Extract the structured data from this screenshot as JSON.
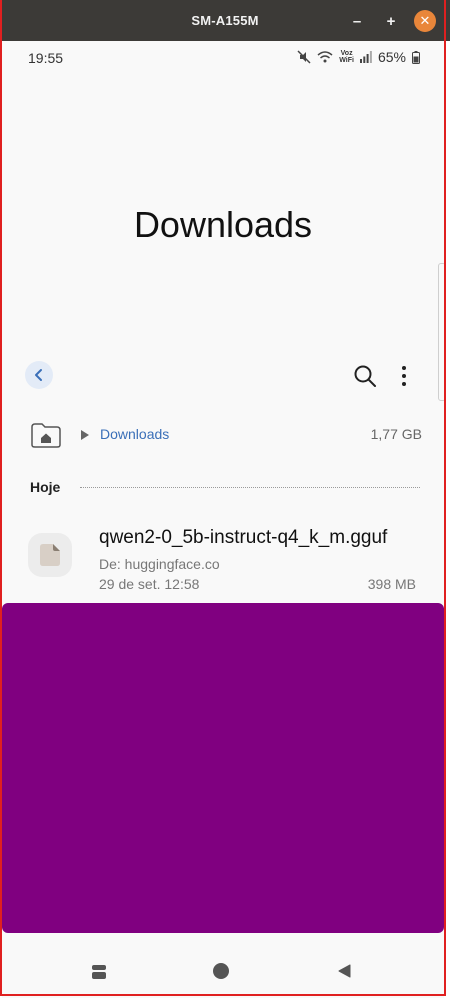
{
  "window": {
    "title": "SM-A155M"
  },
  "status_bar": {
    "time": "19:55",
    "battery": "65%",
    "voz_wifi_line1": "Voz",
    "voz_wifi_line2": "WiFi"
  },
  "header": {
    "title": "Downloads"
  },
  "path": {
    "current": "Downloads",
    "size": "1,77 GB"
  },
  "section": {
    "label": "Hoje"
  },
  "file": {
    "name": "qwen2-0_5b-instruct-q4_k_m.gguf",
    "source": "De: huggingface.co",
    "date": "29 de set. 12:58",
    "size": "398 MB"
  },
  "colors": {
    "accent": "#3a6fb8",
    "overlay": "#800080",
    "titlebar": "#3c3a37",
    "close_button": "#e9863a",
    "frame": "#e02020"
  },
  "icons": [
    "minimize-icon",
    "maximize-icon",
    "close-icon",
    "mute-icon",
    "wifi-icon",
    "signal-icon",
    "battery-icon",
    "back-arrow-icon",
    "search-icon",
    "more-vert-icon",
    "home-folder-icon",
    "play-arrow-icon",
    "file-icon",
    "recents-icon",
    "home-icon",
    "nav-back-icon"
  ]
}
